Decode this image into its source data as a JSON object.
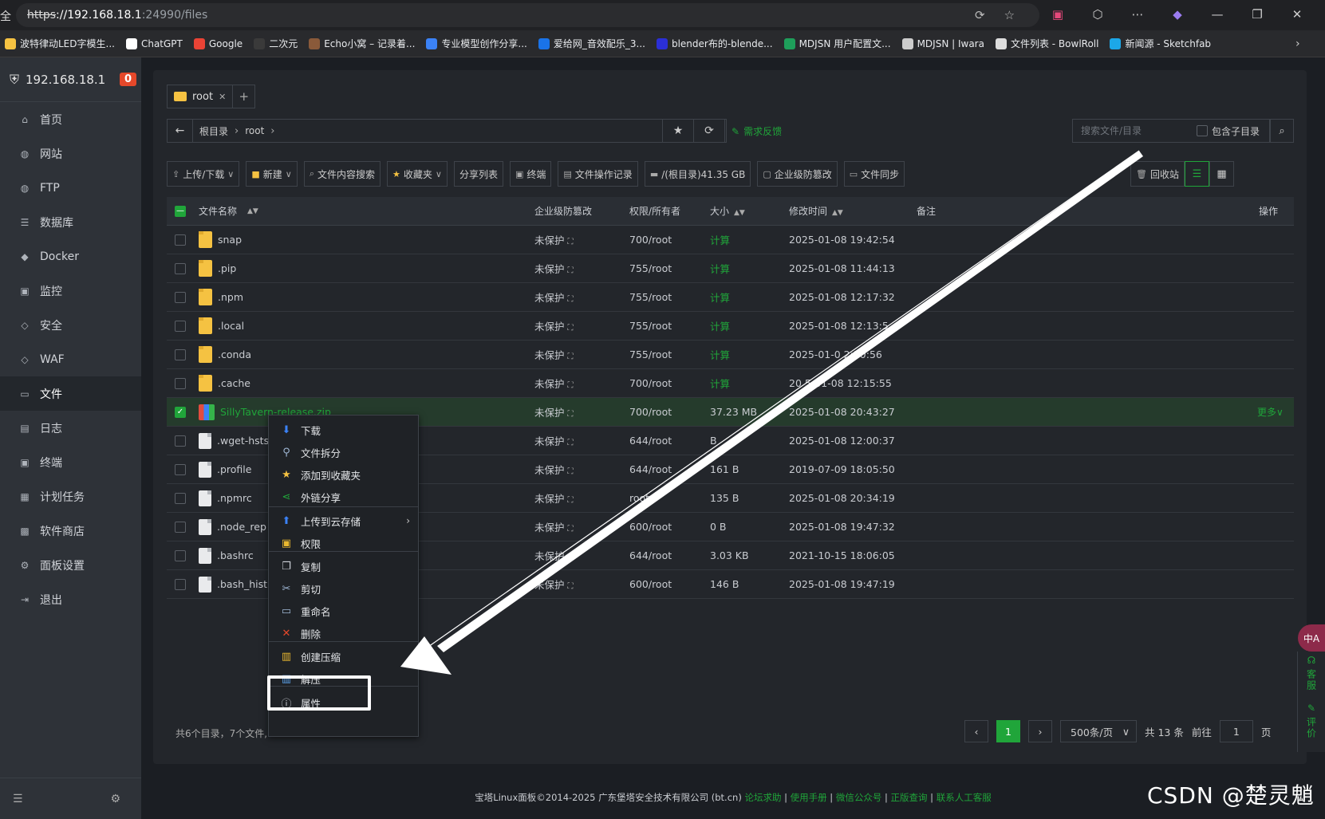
{
  "browser": {
    "url_protocol": "https",
    "url_host": "://192.168.18.1",
    "url_port_path": ":24990/files",
    "left_glyph": "全"
  },
  "bookmarks": [
    {
      "label": "波特律动LED字模生...",
      "color": "#f5c242"
    },
    {
      "label": "ChatGPT",
      "color": "#ffffff"
    },
    {
      "label": "Google",
      "color": "#ea4335"
    },
    {
      "label": "二次元",
      "color": "#3a3a3a"
    },
    {
      "label": "Echo小窝 – 记录着...",
      "color": "#8a5a3a"
    },
    {
      "label": "专业模型创作分享...",
      "color": "#3b82f6"
    },
    {
      "label": "爱给网_音效配乐_3...",
      "color": "#1a73e8"
    },
    {
      "label": "blender布的-blende...",
      "color": "#2b2fd6"
    },
    {
      "label": "MDJSN 用户配置文...",
      "color": "#1e9e5a"
    },
    {
      "label": "MDJSN | Iwara",
      "color": "#cccccc"
    },
    {
      "label": "文件列表 - BowlRoll",
      "color": "#dddddd"
    },
    {
      "label": "新闻源 - Sketchfab",
      "color": "#1ca7e8"
    }
  ],
  "sidebar": {
    "host": "192.168.18.1",
    "badge": "0",
    "items": [
      {
        "label": "首页",
        "icon": "⌂",
        "name": "home"
      },
      {
        "label": "网站",
        "icon": "◍",
        "name": "website"
      },
      {
        "label": "FTP",
        "icon": "◍",
        "name": "ftp"
      },
      {
        "label": "数据库",
        "icon": "☰",
        "name": "database"
      },
      {
        "label": "Docker",
        "icon": "◆",
        "name": "docker"
      },
      {
        "label": "监控",
        "icon": "▣",
        "name": "monitor"
      },
      {
        "label": "安全",
        "icon": "◇",
        "name": "security"
      },
      {
        "label": "WAF",
        "icon": "◇",
        "name": "waf"
      },
      {
        "label": "文件",
        "icon": "▭",
        "name": "files",
        "active": true
      },
      {
        "label": "日志",
        "icon": "▤",
        "name": "logs"
      },
      {
        "label": "终端",
        "icon": "▣",
        "name": "terminal"
      },
      {
        "label": "计划任务",
        "icon": "▦",
        "name": "cron"
      },
      {
        "label": "软件商店",
        "icon": "▩",
        "name": "store"
      },
      {
        "label": "面板设置",
        "icon": "⚙",
        "name": "settings"
      },
      {
        "label": "退出",
        "icon": "⇥",
        "name": "logout"
      }
    ]
  },
  "tabs": {
    "current": "root",
    "add": "+"
  },
  "path": {
    "back": "←",
    "root": "根目录",
    "dir": "root"
  },
  "feedback": "需求反馈",
  "search": {
    "placeholder": "搜索文件/目录",
    "subdir_label": "包含子目录"
  },
  "toolbar": {
    "upload": "上传/下载",
    "new": "新建",
    "content_search": "文件内容搜索",
    "favorites": "收藏夹",
    "share_list": "分享列表",
    "terminal": "终端",
    "op_log": "文件操作记录",
    "disk": "/(根目录)41.35 GB",
    "tamper": "企业级防篡改",
    "sync": "文件同步",
    "recycle": "回收站"
  },
  "table": {
    "headers": {
      "name": "文件名称",
      "protect": "企业级防篡改",
      "perm": "权限/所有者",
      "size": "大小",
      "time": "修改时间",
      "note": "备注",
      "op": "操作"
    },
    "rows": [
      {
        "name": "snap",
        "type": "folder",
        "protect": "未保护",
        "perm": "700/root",
        "size": "计算",
        "time": "2025-01-08 19:42:54"
      },
      {
        "name": ".pip",
        "type": "folder",
        "protect": "未保护",
        "perm": "755/root",
        "size": "计算",
        "time": "2025-01-08 11:44:13"
      },
      {
        "name": ".npm",
        "type": "folder",
        "protect": "未保护",
        "perm": "755/root",
        "size": "计算",
        "time": "2025-01-08 12:17:32"
      },
      {
        "name": ".local",
        "type": "folder",
        "protect": "未保护",
        "perm": "755/root",
        "size": "计算",
        "time": "2025-01-08 12:13:5"
      },
      {
        "name": ".conda",
        "type": "folder",
        "protect": "未保护",
        "perm": "755/root",
        "size": "计算",
        "time": "2025-01-0 2:30:56"
      },
      {
        "name": ".cache",
        "type": "folder",
        "protect": "未保护",
        "perm": "700/root",
        "size": "计算",
        "time": "20 5-01-08 12:15:55"
      },
      {
        "name": "SillyTavern-release.zip",
        "type": "zip",
        "protect": "未保护",
        "perm": "700/root",
        "size": "37.23 MB",
        "time": "2025-01-08 20:43:27",
        "selected": true,
        "op": "更多∨"
      },
      {
        "name": ".wget-hsts",
        "type": "file",
        "protect": "未保护",
        "perm": "644/root",
        "size": "B",
        "time": "2025-01-08 12:00:37"
      },
      {
        "name": ".profile",
        "type": "file",
        "protect": "未保护",
        "perm": "644/root",
        "size": "161 B",
        "time": "2019-07-09 18:05:50"
      },
      {
        "name": ".npmrc",
        "type": "file",
        "protect": "未保护",
        "perm": "root",
        "size": "135 B",
        "time": "2025-01-08 20:34:19"
      },
      {
        "name": ".node_rep",
        "type": "file",
        "protect": "未保护",
        "perm": "600/root",
        "size": "0 B",
        "time": "2025-01-08 19:47:32"
      },
      {
        "name": ".bashrc",
        "type": "file",
        "protect": "未保护",
        "perm": "644/root",
        "size": "3.03 KB",
        "time": "2021-10-15 18:06:05"
      },
      {
        "name": ".bash_hist",
        "type": "file",
        "protect": "未保护",
        "perm": "600/root",
        "size": "146 B",
        "time": "2025-01-08 19:47:19"
      }
    ]
  },
  "summary": "共6个目录，7个文件,",
  "pager": {
    "prev": "‹",
    "current": "1",
    "next": "›",
    "per_page": "500条/页",
    "total": "共 13 条",
    "goto": "前往",
    "goto_value": "1",
    "page_unit": "页"
  },
  "context_menu": [
    {
      "label": "下载",
      "icon": "⬇",
      "color": "#3b82f6"
    },
    {
      "label": "文件拆分",
      "icon": "⚲",
      "color": "#9fb7d4"
    },
    {
      "label": "添加到收藏夹",
      "icon": "★",
      "color": "#f5c242"
    },
    {
      "label": "外链分享",
      "icon": "⋖",
      "color": "#20a53a"
    },
    {
      "label": "上传到云存储",
      "icon": "⬆",
      "color": "#3b82f6",
      "submenu": true
    },
    {
      "label": "权限",
      "icon": "▣",
      "color": "#e9b830"
    },
    {
      "label": "复制",
      "icon": "❐",
      "color": "#cfd3d9"
    },
    {
      "label": "剪切",
      "icon": "✂",
      "color": "#9fb7d4"
    },
    {
      "label": "重命名",
      "icon": "▭",
      "color": "#9fb7d4"
    },
    {
      "label": "删除",
      "icon": "✕",
      "color": "#e5482a"
    },
    {
      "label": "创建压缩",
      "icon": "▥",
      "color": "#e9b830"
    },
    {
      "label": "解压",
      "icon": "▥",
      "color": "#5aa0e8"
    },
    {
      "label": "属性",
      "icon": "ⓘ",
      "color": "#cfd3d9"
    }
  ],
  "copyright": {
    "text": "宝塔Linux面板©2014-2025 广东堡塔安全技术有限公司 (bt.cn)",
    "links": [
      "论坛求助",
      "使用手册",
      "微信公众号",
      "正版查询",
      "联系人工客服"
    ]
  },
  "float": {
    "translate": "中A",
    "service": "客服",
    "review": "评价"
  },
  "watermark": "CSDN @楚灵魈"
}
